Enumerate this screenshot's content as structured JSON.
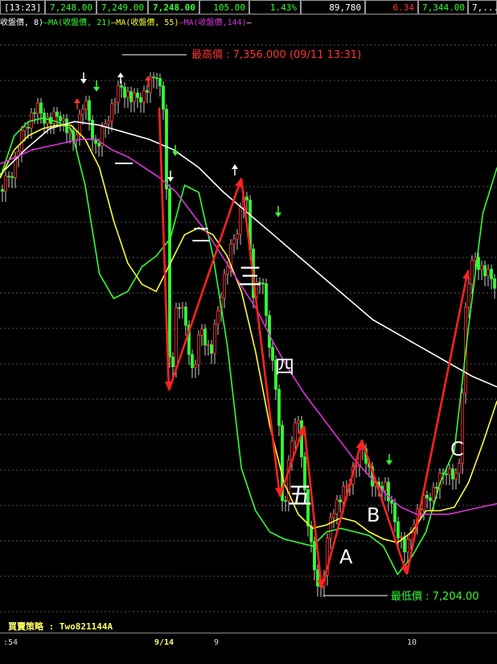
{
  "quote_bar": {
    "cells": [
      {
        "text": "[13:23]",
        "color": "#ffffff"
      },
      {
        "text": "7,248.00",
        "color": "#33ff33"
      },
      {
        "text": "7,249.00",
        "color": "#33ff33"
      },
      {
        "text": "7,248.00",
        "color": "#33ff33",
        "bold": true
      },
      {
        "text": "105.00",
        "color": "#33ff33"
      },
      {
        "text": "1.43%",
        "color": "#33ff33"
      },
      {
        "text": "89,780",
        "color": "#ffffff"
      },
      {
        "text": "6.34",
        "color": "#ff3333"
      },
      {
        "text": "7,344.00",
        "color": "#33ff33"
      },
      {
        "text": "7,...",
        "color": "#ffffff"
      }
    ]
  },
  "legend": {
    "items": [
      {
        "text": "收盤價,  8)",
        "color": "#ffffff"
      },
      {
        "text": "—MA(收盤價, 21)",
        "color": "#33ff33"
      },
      {
        "text": "—MA(收盤價, 55)",
        "color": "#ffff33"
      },
      {
        "text": "—MA(收盤價,144)",
        "color": "#dd33dd"
      },
      {
        "text": "—",
        "color": "#ffffff"
      }
    ]
  },
  "annotations": {
    "high": "最高價 : 7,356.000 (09/11 13:31)",
    "low": "最低價 : 7,204.00",
    "waves": [
      "一",
      "二",
      "三",
      "四",
      "五",
      "A",
      "B",
      "C"
    ]
  },
  "strategy_label": "買賣策略 : Two821144A",
  "time_axis": [
    ":54",
    "9/14",
    "9",
    "10"
  ],
  "chart_data": {
    "type": "line",
    "title": "",
    "high_value": 7356.0,
    "low_value": 7204.0,
    "series": [
      {
        "name": "MA(收盤價, 21)",
        "color": "#33ff33",
        "values": [
          7322,
          7334,
          7338,
          7339,
          7338,
          7336,
          7320,
          7295,
          7288,
          7290,
          7297,
          7300,
          7305,
          7320,
          7318,
          7300,
          7275,
          7240,
          7228,
          7222,
          7220,
          7219,
          7218,
          7222,
          7223,
          7222,
          7221,
          7218,
          7210,
          7215,
          7222,
          7236,
          7245,
          7280,
          7312,
          7325
        ]
      },
      {
        "name": "MA(收盤價, 55)",
        "color": "#ffff33",
        "values": [
          7322,
          7330,
          7334,
          7336,
          7337,
          7337,
          7333,
          7325,
          7310,
          7298,
          7292,
          7290,
          7298,
          7306,
          7308,
          7306,
          7300,
          7290,
          7273,
          7252,
          7236,
          7227,
          7223,
          7224,
          7226,
          7225,
          7222,
          7220,
          7219,
          7222,
          7228,
          7228,
          7229,
          7236,
          7247,
          7259
        ]
      },
      {
        "name": "MA(收盤價,144)",
        "color": "#dd33dd",
        "values": [
          7326,
          7328,
          7330,
          7331,
          7332,
          7333,
          7333,
          7330,
          7328,
          7325,
          7322,
          7318,
          7312,
          7306,
          7299,
          7292,
          7285,
          7276,
          7268,
          7261,
          7255,
          7249,
          7243,
          7238,
          7233,
          7229,
          7227,
          7227,
          7227,
          7228,
          7229,
          7230
        ]
      }
    ]
  }
}
